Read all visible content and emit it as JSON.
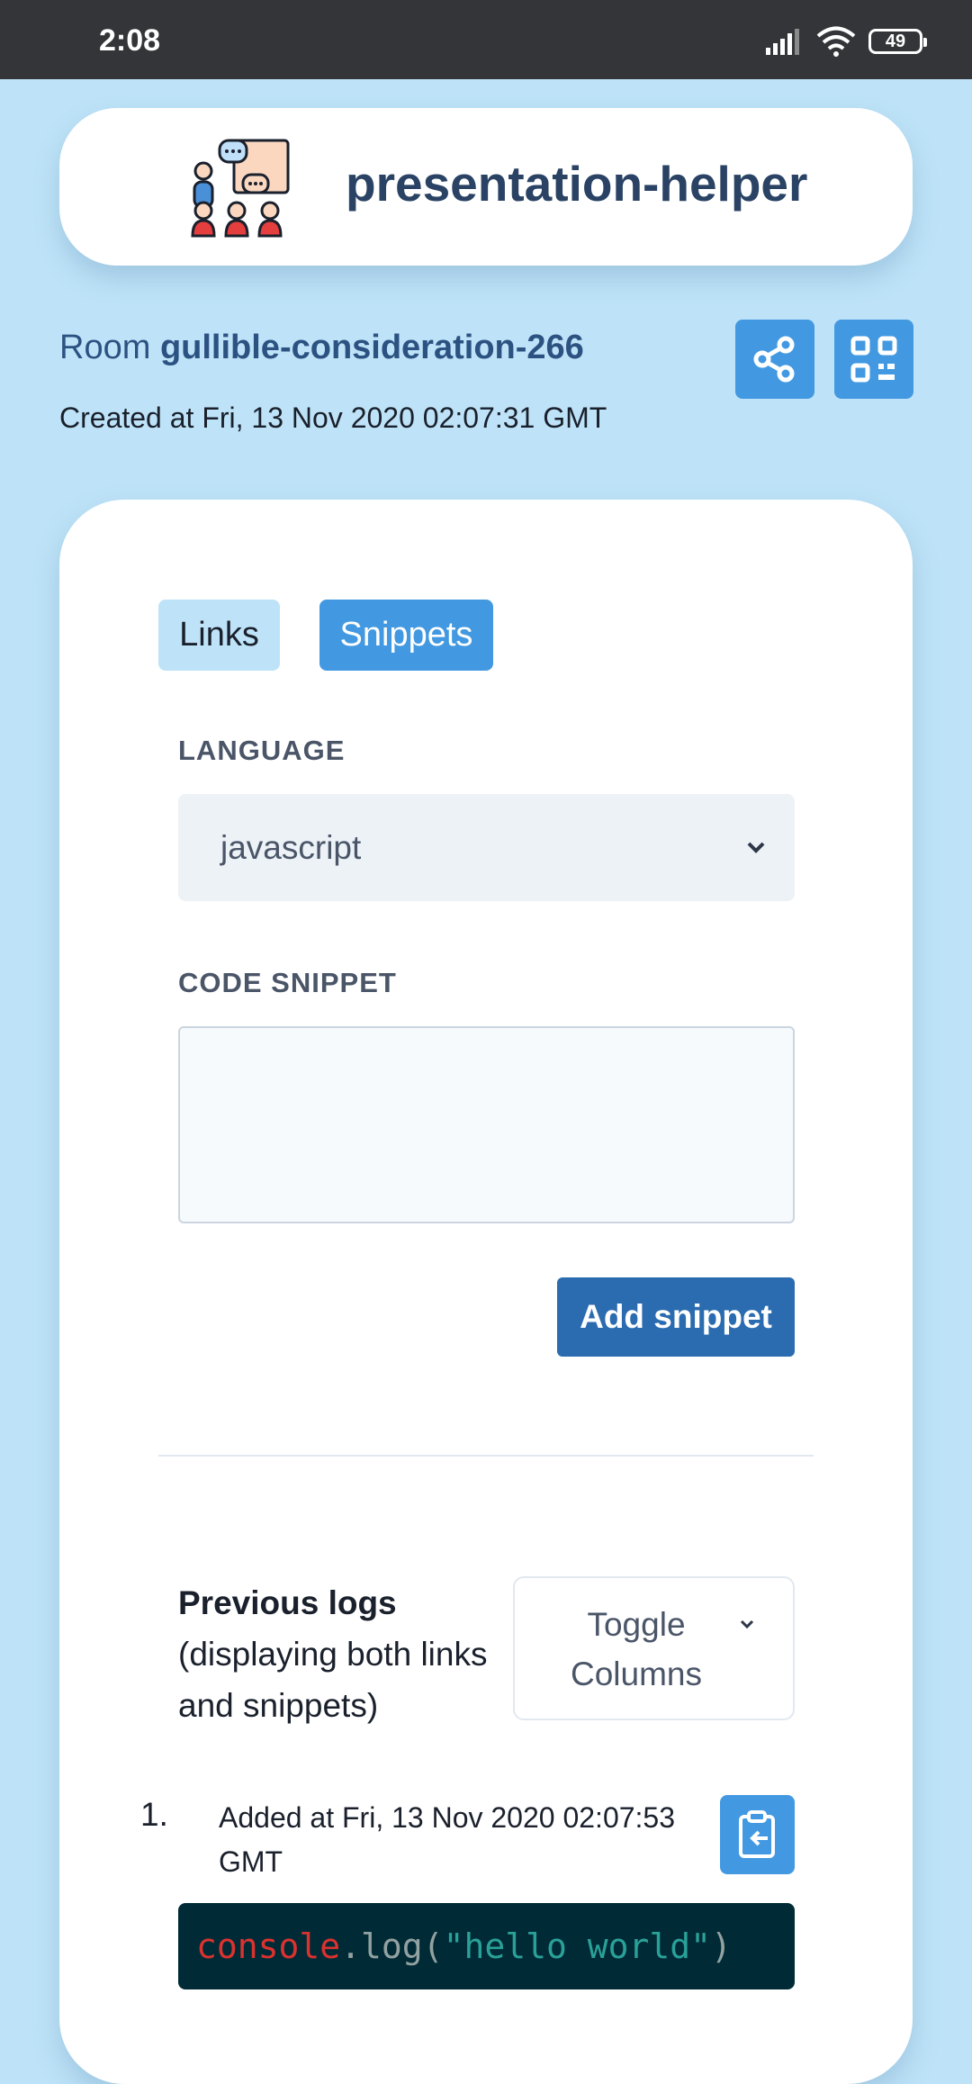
{
  "status_bar": {
    "time": "2:08",
    "battery": "49"
  },
  "header": {
    "app_title": "presentation-helper",
    "logo_icon": "presentation-audience-icon"
  },
  "room": {
    "prefix": "Room",
    "name": "gullible-consideration-266",
    "created": "Created at Fri, 13 Nov 2020 02:07:31 GMT",
    "share_icon": "share-icon",
    "qr_icon": "qr-code-icon"
  },
  "tabs": [
    {
      "label": "Links",
      "active": false
    },
    {
      "label": "Snippets",
      "active": true
    }
  ],
  "form": {
    "language_label": "LANGUAGE",
    "language_value": "javascript",
    "code_label": "CODE SNIPPET",
    "code_value": "",
    "submit_label": "Add snippet"
  },
  "logs": {
    "heading": "Previous logs",
    "subheading": "(displaying both links and snippets)",
    "toggle_label": "Toggle Columns",
    "items": [
      {
        "number": "1.",
        "added": "Added at Fri, 13 Nov 2020 02:07:53 GMT",
        "code": {
          "object": "console",
          "dot": ".",
          "method": "log(",
          "string": "\"hello world\"",
          "close": ")"
        }
      }
    ]
  },
  "colors": {
    "background": "#bee3f8",
    "accent": "#4299e1",
    "primary_button": "#2b6cb0",
    "code_background": "#002b36"
  }
}
